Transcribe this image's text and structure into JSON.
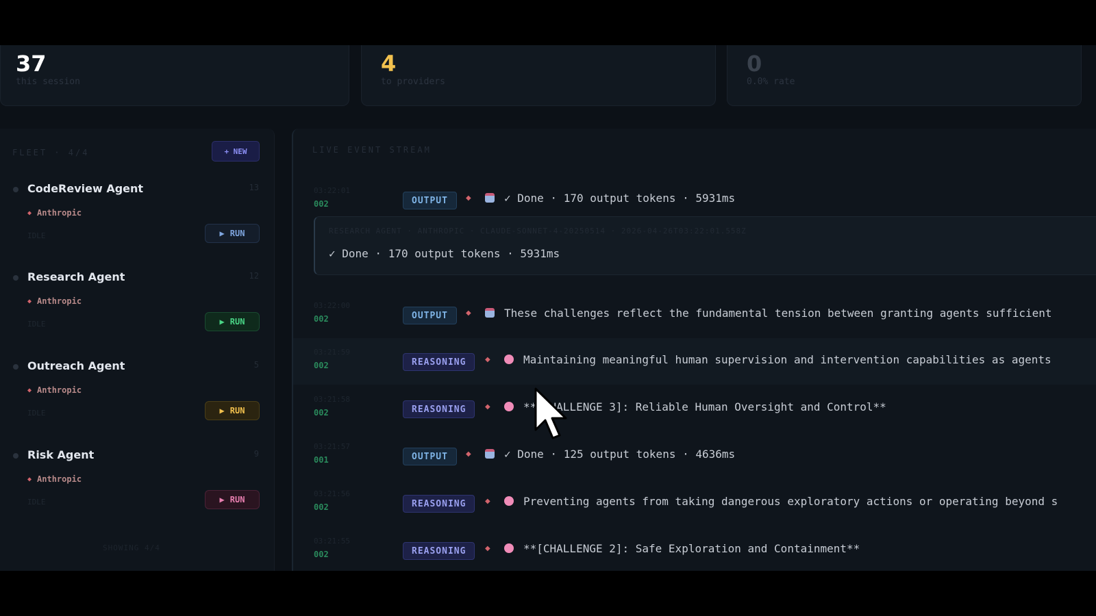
{
  "stats": [
    {
      "value": "37",
      "label": "this session",
      "color": "#ffffff"
    },
    {
      "value": "4",
      "label": "to providers",
      "color": "#f2c14e"
    },
    {
      "value": "0",
      "label": "0.0% rate",
      "color": "#3a424d"
    }
  ],
  "fleet": {
    "title": "FLEET · 4/4",
    "new_button": "+ NEW",
    "footer": "SHOWING 4/4",
    "agents": [
      {
        "name": "CodeReview Agent",
        "count": "13",
        "provider": "Anthropic",
        "status": "IDLE",
        "run_label": "RUN",
        "run_color": "#7fa6e0",
        "run_bg": "#141d2a",
        "run_border": "#22324a"
      },
      {
        "name": "Research Agent",
        "count": "12",
        "provider": "Anthropic",
        "status": "IDLE",
        "run_label": "RUN",
        "run_color": "#4ad486",
        "run_bg": "#0f2a1c",
        "run_border": "#1a4a30"
      },
      {
        "name": "Outreach Agent",
        "count": "5",
        "provider": "Anthropic",
        "status": "IDLE",
        "run_label": "RUN",
        "run_color": "#f2c14e",
        "run_bg": "#2b2410",
        "run_border": "#4a3e18"
      },
      {
        "name": "Risk Agent",
        "count": "9",
        "provider": "Anthropic",
        "status": "IDLE",
        "run_label": "RUN",
        "run_color": "#e87fb0",
        "run_bg": "#2a1420",
        "run_border": "#4a2236"
      }
    ]
  },
  "stream": {
    "title": "LIVE EVENT STREAM",
    "detail": {
      "meta": "RESEARCH AGENT · ANTHROPIC · CLAUDE-SONNET-4-20250514 · 2026-04-26T03:22:01.558Z",
      "text": "✓ Done · 170 output tokens · 5931ms"
    },
    "events": [
      {
        "time": "03:22:01",
        "num": "002",
        "type": "OUTPUT",
        "icon": "robot-icon",
        "text": "✓ Done · 170 output tokens · 5931ms"
      },
      {
        "time": "03:22:00",
        "num": "002",
        "type": "OUTPUT",
        "icon": "robot-icon",
        "text": "These challenges reflect the fundamental tension between granting agents sufficient"
      },
      {
        "time": "03:21:59",
        "num": "002",
        "type": "REASONING",
        "icon": "brain-icon",
        "text": "Maintaining meaningful human supervision and intervention capabilities as agents"
      },
      {
        "time": "03:21:58",
        "num": "002",
        "type": "REASONING",
        "icon": "brain-icon",
        "text": "**[CHALLENGE 3]: Reliable Human Oversight and Control**"
      },
      {
        "time": "03:21:57",
        "num": "001",
        "type": "OUTPUT",
        "icon": "robot-icon",
        "text": "✓ Done · 125 output tokens · 4636ms"
      },
      {
        "time": "03:21:56",
        "num": "002",
        "type": "REASONING",
        "icon": "brain-icon",
        "text": "Preventing agents from taking dangerous exploratory actions or operating beyond s"
      },
      {
        "time": "03:21:55",
        "num": "002",
        "type": "REASONING",
        "icon": "brain-icon",
        "text": "**[CHALLENGE 2]: Safe Exploration and Containment**"
      }
    ]
  }
}
